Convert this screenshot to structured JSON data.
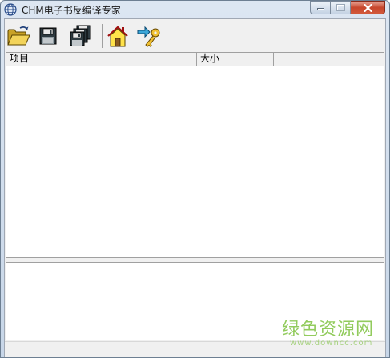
{
  "window": {
    "title": "CHM电子书反编译专家",
    "app_icon": "globe-icon"
  },
  "toolbar": {
    "buttons": [
      {
        "icon": "open-folder-icon"
      },
      {
        "icon": "save-disk-icon"
      },
      {
        "icon": "save-all-icon"
      },
      {
        "icon": "home-icon"
      },
      {
        "icon": "key-arrow-icon"
      }
    ]
  },
  "list": {
    "columns": [
      "项目",
      "大小",
      ""
    ]
  },
  "watermark": {
    "main": "绿色资源网",
    "url": "www.downcc.com"
  },
  "colors": {
    "watermark_green": "#7fc341",
    "close_red": "#c7462c"
  }
}
